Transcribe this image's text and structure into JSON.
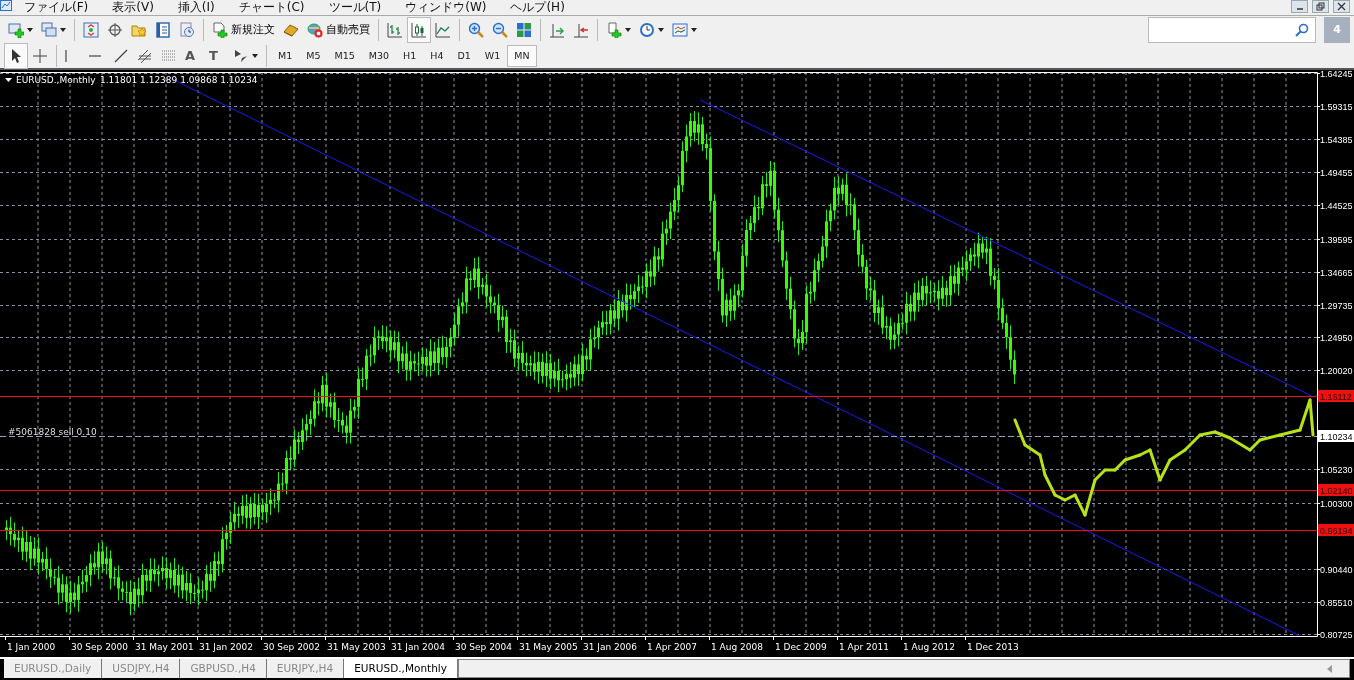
{
  "menu": [
    "ファイル(F)",
    "表示(V)",
    "挿入(I)",
    "チャート(C)",
    "ツール(T)",
    "ウィンドウ(W)",
    "ヘルプ(H)"
  ],
  "toolbar": [
    {
      "kind": "new-chart",
      "dropdown": true
    },
    {
      "kind": "profiles",
      "dropdown": true
    },
    {
      "kind": "separator"
    },
    {
      "kind": "market-watch"
    },
    {
      "kind": "crosshair-circle"
    },
    {
      "kind": "data-window"
    },
    {
      "kind": "navigator"
    },
    {
      "kind": "tester"
    },
    {
      "kind": "separator"
    },
    {
      "kind": "new-order",
      "label": "新規注文"
    },
    {
      "kind": "expert"
    },
    {
      "kind": "auto-trading",
      "label": "自動売買"
    },
    {
      "kind": "separator"
    },
    {
      "kind": "bar-chart",
      "selected": false
    },
    {
      "kind": "candle-chart",
      "selected": true
    },
    {
      "kind": "line-chart",
      "selected": false
    },
    {
      "kind": "separator"
    },
    {
      "kind": "zoom-in"
    },
    {
      "kind": "zoom-out"
    },
    {
      "kind": "tile"
    },
    {
      "kind": "separator"
    },
    {
      "kind": "autoscroll"
    },
    {
      "kind": "chart-shift"
    },
    {
      "kind": "separator"
    },
    {
      "kind": "indicators",
      "dropdown": true
    },
    {
      "kind": "periods",
      "dropdown": true
    },
    {
      "kind": "templates",
      "dropdown": true
    }
  ],
  "notifications": {
    "count": "4"
  },
  "tools": [
    {
      "kind": "cursor",
      "selected": true
    },
    {
      "kind": "cross",
      "selected": false
    },
    {
      "kind": "separator"
    },
    {
      "kind": "vline"
    },
    {
      "kind": "hline"
    },
    {
      "kind": "trendline"
    },
    {
      "kind": "fibo-channel"
    },
    {
      "kind": "fibo"
    },
    {
      "kind": "text",
      "glyph": "A"
    },
    {
      "kind": "label",
      "glyph": "T"
    },
    {
      "kind": "arrows",
      "dropdown": true
    }
  ],
  "timeframes": [
    {
      "label": "M1",
      "selected": false
    },
    {
      "label": "M5",
      "selected": false
    },
    {
      "label": "M15",
      "selected": false
    },
    {
      "label": "M30",
      "selected": false
    },
    {
      "label": "H1",
      "selected": false
    },
    {
      "label": "H4",
      "selected": false
    },
    {
      "label": "D1",
      "selected": false
    },
    {
      "label": "W1",
      "selected": false
    },
    {
      "label": "MN",
      "selected": true
    }
  ],
  "chart": {
    "symbol": "EURUSD.,Monthly",
    "ohlc": "1.11801 1.12389 1.09868 1.10234",
    "order_label": "#5061828 sell 0.10",
    "price_labels": [
      {
        "kind": "tick",
        "text": "1.64245"
      },
      {
        "kind": "tick",
        "text": "1.59315"
      },
      {
        "kind": "tick",
        "text": "1.54385"
      },
      {
        "kind": "tick",
        "text": "1.49455"
      },
      {
        "kind": "tick",
        "text": "1.44525"
      },
      {
        "kind": "tick",
        "text": "1.39595"
      },
      {
        "kind": "tick",
        "text": "1.34665"
      },
      {
        "kind": "tick",
        "text": "1.29735"
      },
      {
        "kind": "tick",
        "text": "1.24950"
      },
      {
        "kind": "tick",
        "text": "1.20020"
      },
      {
        "kind": "level",
        "text": "1.16112"
      },
      {
        "kind": "current",
        "text": "1.10234"
      },
      {
        "kind": "tick",
        "text": "1.05230"
      },
      {
        "kind": "level",
        "text": "1.02140"
      },
      {
        "kind": "tick",
        "text": "1.00300"
      },
      {
        "kind": "level",
        "text": "0.96194"
      },
      {
        "kind": "tick",
        "text": "0.90440"
      },
      {
        "kind": "tick",
        "text": "0.85510"
      },
      {
        "kind": "tick",
        "text": "0.80725"
      }
    ],
    "time_labels": [
      "1 Jan 2000",
      "30 Sep 2000",
      "31 May 2001",
      "31 Jan 2002",
      "30 Sep 2002",
      "31 May 2003",
      "31 Jan 2004",
      "30 Sep 2004",
      "31 May 2005",
      "31 Jan 2006",
      "1 Apr 2007",
      "1 Aug 2008",
      "1 Dec 2009",
      "1 Apr 2011",
      "1 Aug 2012",
      "1 Dec 2013"
    ]
  },
  "tabs": [
    {
      "label": "EURUSD.,Daily",
      "selected": false
    },
    {
      "label": "USDJPY.,H4",
      "selected": false
    },
    {
      "label": "GBPUSD.,H4",
      "selected": false
    },
    {
      "label": "EURJPY.,H4",
      "selected": false
    },
    {
      "label": "EURUSD.,Monthly",
      "selected": true
    }
  ]
}
